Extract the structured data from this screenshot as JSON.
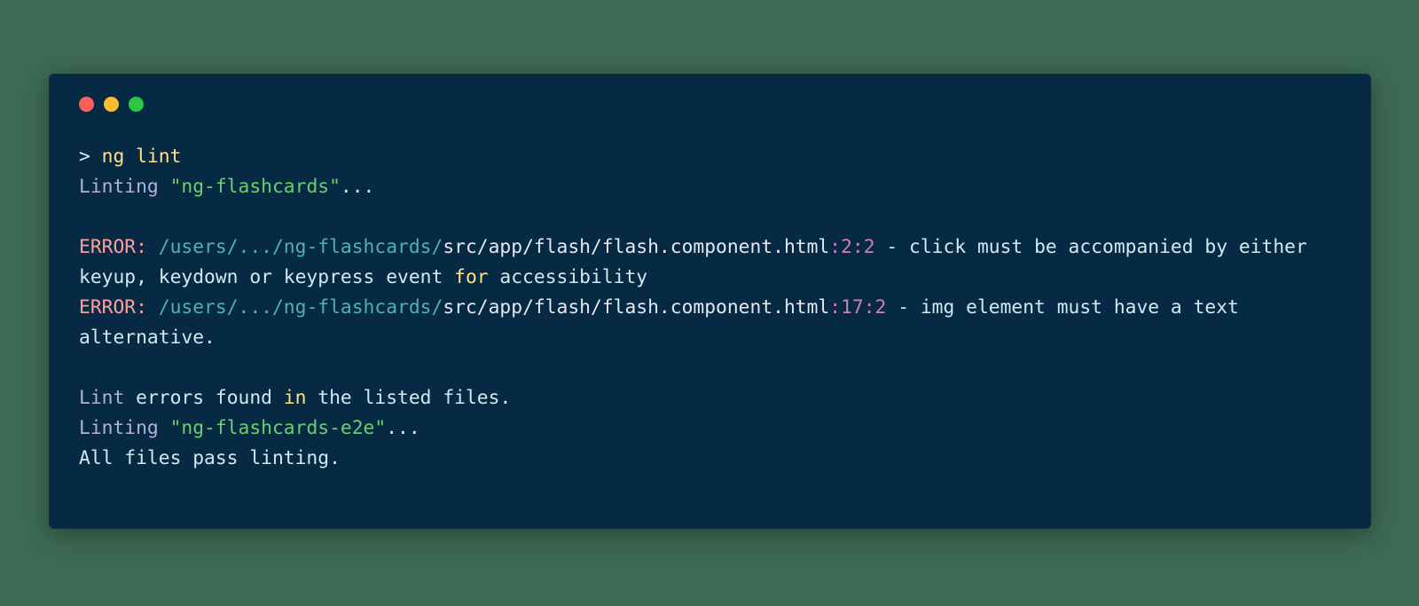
{
  "prompt": "> ",
  "command": "ng lint",
  "lint1": {
    "label": "Linting ",
    "project": "\"ng-flashcards\"",
    "dots": "..."
  },
  "err1": {
    "label": "ERROR: ",
    "path": "/users/.../ng-flashcards/",
    "file": "src/app/flash/flash.component.html",
    "loc": ":2:2",
    "dash": " - ",
    "msg_a": "click must be accompanied by either keyup, keydown or keypress event ",
    "for_kw": "for",
    "msg_b": " accessibility"
  },
  "err2": {
    "label": "ERROR: ",
    "path": "/users/.../ng-flashcards/",
    "file": "src/app/flash/flash.component.html",
    "loc": ":17:2",
    "dash": " - ",
    "msg": "img element must have a text alternative."
  },
  "summary": {
    "a": "Lint",
    "b": " errors found ",
    "in_kw": "in",
    "c": " the listed files."
  },
  "lint2": {
    "label": "Linting ",
    "project": "\"ng-flashcards-e2e\"",
    "dots": "..."
  },
  "pass": "All files pass linting."
}
